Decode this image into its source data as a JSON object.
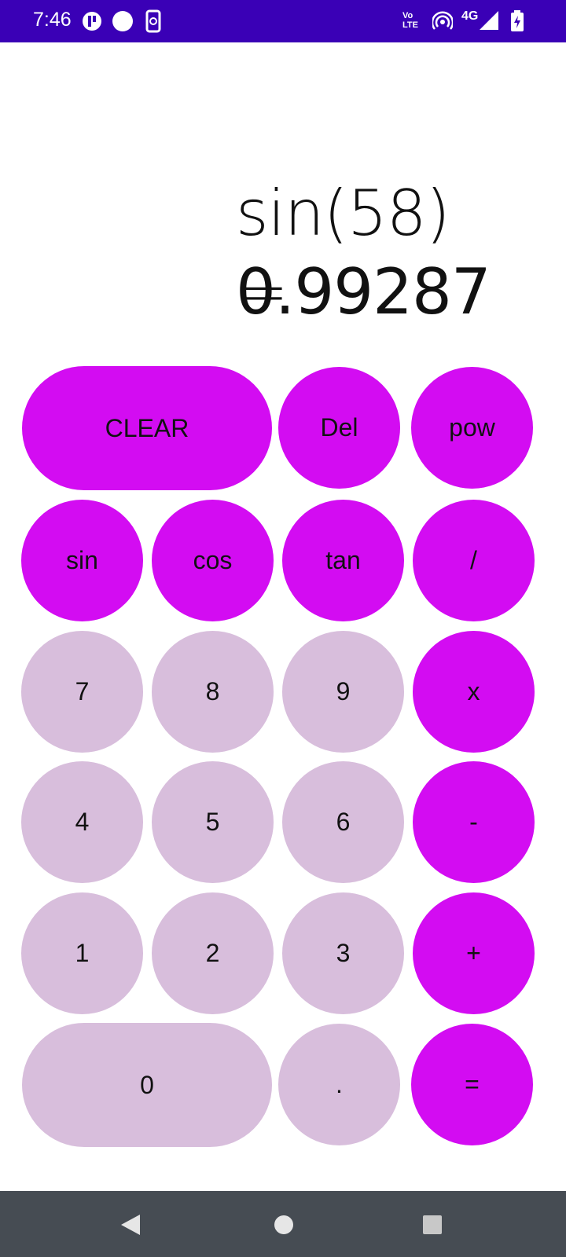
{
  "status_bar": {
    "time": "7:46",
    "network": "4G",
    "volte": "Vo LTE",
    "background_color": "#3a00b6"
  },
  "display": {
    "expression": "sin(58) =",
    "result": "0.99287"
  },
  "keypad": {
    "accent_color": "#d30cf2",
    "number_color": "#d8bedc",
    "rows": [
      [
        "CLEAR",
        "Del",
        "pow"
      ],
      [
        "sin",
        "cos",
        "tan",
        "/"
      ],
      [
        "7",
        "8",
        "9",
        "x"
      ],
      [
        "4",
        "5",
        "6",
        "-"
      ],
      [
        "1",
        "2",
        "3",
        "+"
      ],
      [
        "0",
        ".",
        "="
      ]
    ]
  },
  "nav_bar": {
    "icons": [
      "back-icon",
      "home-icon",
      "recents-icon"
    ]
  }
}
